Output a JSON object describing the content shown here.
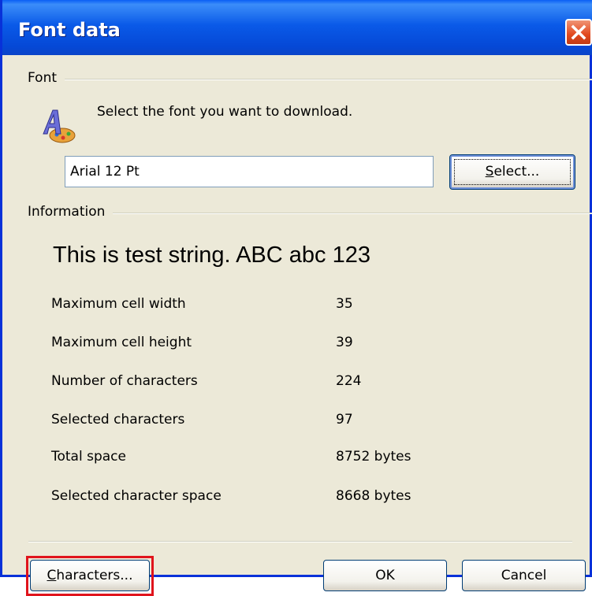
{
  "window": {
    "title": "Font data",
    "close_label": "✕"
  },
  "font_group": {
    "label": "Font",
    "instruction": "Select the font you want to download.",
    "font_value": "Arial 12 Pt",
    "select_button": {
      "underline": "S",
      "rest": "elect..."
    }
  },
  "info_group": {
    "label": "Information",
    "sample_text": "This is test string. ABC abc 123",
    "rows": [
      {
        "label": "Maximum cell width",
        "value": "35"
      },
      {
        "label": "Maximum cell height",
        "value": "39"
      },
      {
        "label": "Number of characters",
        "value": "224"
      },
      {
        "label": "Selected characters",
        "value": "97"
      },
      {
        "label": "Total space",
        "value": "8752 bytes"
      },
      {
        "label": "Selected character space",
        "value": "8668 bytes"
      }
    ]
  },
  "buttons": {
    "characters": {
      "underline": "C",
      "rest": "haracters..."
    },
    "ok": "OK",
    "cancel": "Cancel"
  },
  "colors": {
    "titlebar": "#0A5AE8",
    "dialog_bg": "#ECE9D8",
    "highlight": "#E0141C"
  },
  "icons": {
    "font_app_icon": "font-palette-icon",
    "close": "close-icon"
  }
}
